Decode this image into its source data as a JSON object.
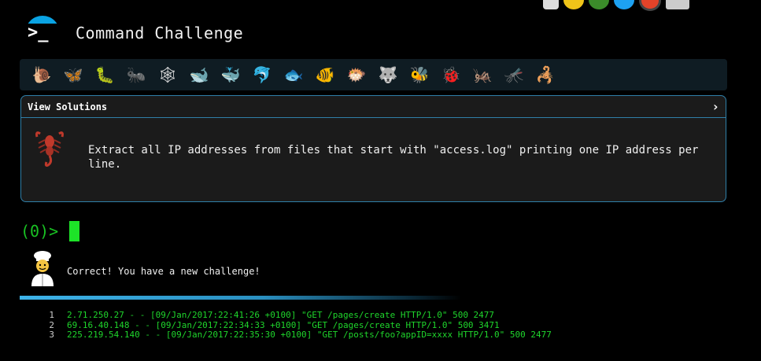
{
  "app": {
    "title": "Command Challenge"
  },
  "top_icons": [
    "terminal-icon",
    "lightbulb-icon",
    "tree-icon",
    "twitter-bird-icon",
    "gitlab-icon",
    "envelope-icon"
  ],
  "critters": [
    {
      "name": "snail",
      "glyph": "🐌"
    },
    {
      "name": "butterfly",
      "glyph": "🦋"
    },
    {
      "name": "caterpillar",
      "glyph": "🐛"
    },
    {
      "name": "ant",
      "glyph": "🐜"
    },
    {
      "name": "spider-web",
      "glyph": "🕸"
    },
    {
      "name": "whale",
      "glyph": "🐋"
    },
    {
      "name": "spouting-whale",
      "glyph": "🐳"
    },
    {
      "name": "dolphin",
      "glyph": "🐬"
    },
    {
      "name": "fish",
      "glyph": "🐟"
    },
    {
      "name": "tropical-fish",
      "glyph": "🐠"
    },
    {
      "name": "blowfish",
      "glyph": "🐡"
    },
    {
      "name": "wolf",
      "glyph": "🐺"
    },
    {
      "name": "bee",
      "glyph": "🐝"
    },
    {
      "name": "ladybug",
      "glyph": "🐞"
    },
    {
      "name": "cricket",
      "glyph": "🦗"
    },
    {
      "name": "mosquito",
      "glyph": "🦟"
    },
    {
      "name": "scorpion",
      "glyph": "🦂"
    }
  ],
  "panel": {
    "header": "View Solutions",
    "chevron": "›",
    "task": "Extract all IP addresses from files that start with \"access.log\" printing one IP address per line."
  },
  "prompt": {
    "text": "(0)>"
  },
  "feedback": {
    "message": "Correct! You have a new challenge!"
  },
  "progress": {
    "fraction": 0.58
  },
  "output": {
    "lines": [
      {
        "num": "1",
        "text": "2.71.250.27 - - [09/Jan/2017:22:41:26 +0100] \"GET /pages/create HTTP/1.0\" 500 2477"
      },
      {
        "num": "2",
        "text": "69.16.40.148 - - [09/Jan/2017:22:34:33 +0100] \"GET /pages/create HTTP/1.0\" 500 3471"
      },
      {
        "num": "3",
        "text": "225.219.54.140 - - [09/Jan/2017:22:35:30 +0100] \"GET /posts/foo?appID=xxxx HTTP/1.0\" 500 2477"
      }
    ]
  },
  "colors": {
    "accent": "#2f7fa8",
    "prompt_green": "#19c223",
    "output_green": "#1fd62c",
    "progress_blue": "#3eb4ea"
  }
}
